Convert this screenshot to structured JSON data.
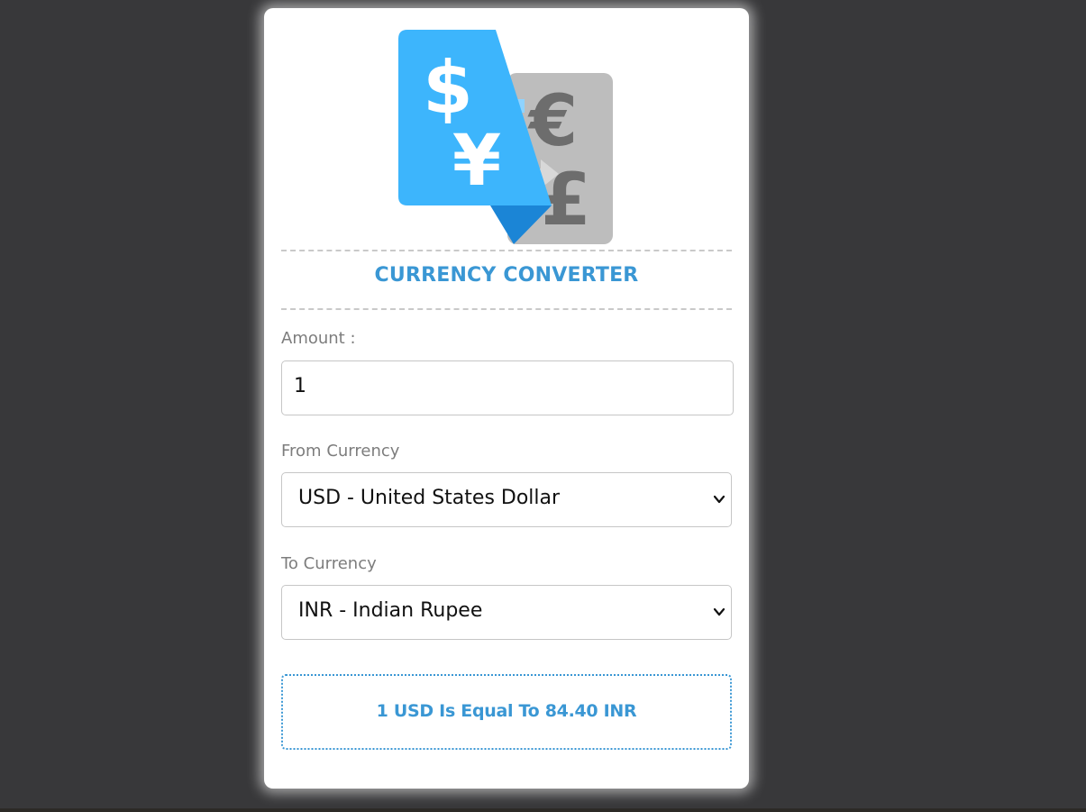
{
  "converter": {
    "title": "CURRENCY CONVERTER",
    "amount_label": "Amount :",
    "amount_value": "1",
    "from_label": "From Currency",
    "from_selected": "USD - United States Dollar",
    "to_label": "To Currency",
    "to_selected": "INR - Indian Rupee",
    "result_text": "1 USD Is Equal To 84.40 INR"
  },
  "logo": {
    "icon": "currency-exchange-icon",
    "symbols": [
      "$",
      "¥",
      "€",
      "£"
    ]
  },
  "colors": {
    "accent": "#3a97d4",
    "background": "#38383a",
    "card": "#ffffff",
    "logo_blue": "#3db5fc",
    "logo_gray": "#bdbdbd"
  }
}
